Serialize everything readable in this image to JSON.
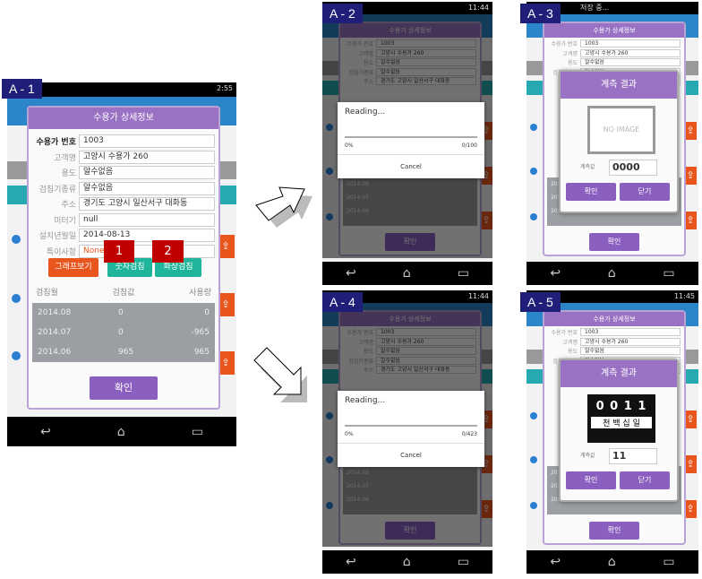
{
  "labels": {
    "a1": "A - 1",
    "a2": "A - 2",
    "a3": "A - 3",
    "a4": "A - 4",
    "a5": "A - 5",
    "badge1": "1",
    "badge2": "2"
  },
  "detail": {
    "title": "수용가 상세정보",
    "fields": [
      {
        "label": "수용가 번호",
        "value": "1003"
      },
      {
        "label": "고객명",
        "value": "고양시 수용가 260"
      },
      {
        "label": "용도",
        "value": "알수없음"
      },
      {
        "label": "검침기종류",
        "value": "알수없음"
      },
      {
        "label": "주소",
        "value": "경기도 고양시 일산서구 대화동"
      },
      {
        "label": "미터기",
        "value": "null"
      },
      {
        "label": "설치년월일",
        "value": "2014-08-13"
      },
      {
        "label": "특이사항",
        "value": "None"
      }
    ],
    "buttons": {
      "graph": "그래프보기",
      "number": "숫자검침",
      "image": "화상검침",
      "ok": "확인"
    },
    "table": {
      "headers": [
        "검침월",
        "검침값",
        "사용량"
      ],
      "rows": [
        [
          "2014.08",
          "0",
          "0"
        ],
        [
          "2014.07",
          "0",
          "-965"
        ],
        [
          "2014.06",
          "965",
          "965"
        ]
      ]
    }
  },
  "status": {
    "a1_time": "2:55",
    "a2_time": "11:44",
    "a3_text": "저장 중...",
    "a4_time": "11:44",
    "a5_time": "11:45"
  },
  "reading_a2": {
    "title": "Reading...",
    "percent": "0%",
    "count": "0/100",
    "cancel": "Cancel",
    "progress": 0
  },
  "reading_a4": {
    "title": "Reading...",
    "percent": "0%",
    "count": "0/423",
    "cancel": "Cancel",
    "progress": 0
  },
  "result_a3": {
    "title": "계측 결과",
    "image_placeholder": "NO IMAGE",
    "value_label": "계측값",
    "value": "0000",
    "ok": "확인",
    "close": "닫기"
  },
  "result_a5": {
    "title": "계측 결과",
    "value_label": "계측값",
    "value": "11",
    "ok": "확인",
    "close": "닫기",
    "meter_digits": "0 0 1 1",
    "meter_units": "천 백 십 일"
  },
  "colors": {
    "purple": "#9a72c4",
    "orange": "#e8561e",
    "teal": "#1fb59a",
    "tag": "#1f1f7a",
    "badge": "#c00000"
  }
}
